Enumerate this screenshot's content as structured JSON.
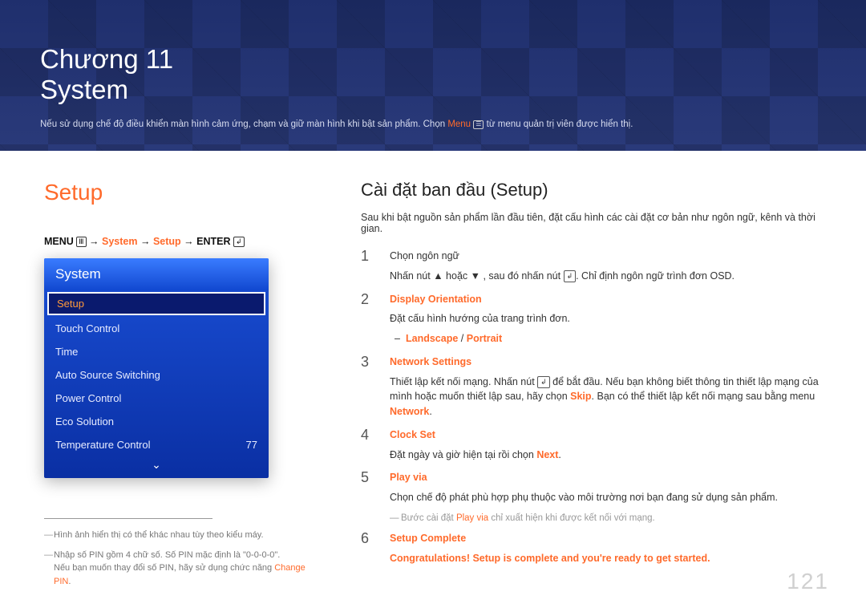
{
  "hero": {
    "chapter": "Chương 11",
    "title": "System",
    "note_pre": "Nếu sử dụng chế độ điều khiển màn hình cảm ứng, chạm và giữ màn hình khi bật sản phẩm. Chọn ",
    "note_menu": "Menu",
    "note_post": " từ menu quản trị viên được hiển thị."
  },
  "left": {
    "heading": "Setup",
    "breadcrumb": {
      "menu": "MENU",
      "arrow": "→",
      "p1": "System",
      "p2": "Setup",
      "enter": "ENTER"
    },
    "osd": {
      "header": "System",
      "items": [
        {
          "label": "Setup",
          "selected": true
        },
        {
          "label": "Touch Control"
        },
        {
          "label": "Time"
        },
        {
          "label": "Auto Source Switching"
        },
        {
          "label": "Power Control"
        },
        {
          "label": "Eco Solution"
        },
        {
          "label": "Temperature Control",
          "value": "77"
        }
      ],
      "more": "⌄"
    },
    "footnote1": "Hình ảnh hiển thị có thể khác nhau tùy theo kiểu máy.",
    "footnote2_a": "Nhập số PIN gồm 4 chữ số. Số PIN mặc định là \"0-0-0-0\".",
    "footnote2_b_pre": "Nếu bạn muốn thay đổi số PIN, hãy sử dụng chức năng ",
    "footnote2_b_hl": "Change PIN",
    "footnote2_b_post": "."
  },
  "right": {
    "heading": "Cài đặt ban đầu (Setup)",
    "intro": "Sau khi bật nguồn sản phẩm lần đầu tiên, đặt cấu hình các cài đặt cơ bản như ngôn ngữ, kênh và thời gian.",
    "steps": {
      "s1": {
        "num": "1",
        "line1": "Chọn ngôn ngữ",
        "line2_a": "Nhấn nút ▲ hoặc ▼ , sau đó nhấn nút ",
        "line2_b": ". Chỉ định ngôn ngữ trình đơn OSD."
      },
      "s2": {
        "num": "2",
        "title": "Display Orientation",
        "line1": "Đặt cấu hình hướng của trang trình đơn.",
        "sub_a": "Landscape",
        "sub_sep": " / ",
        "sub_b": "Portrait"
      },
      "s3": {
        "num": "3",
        "title": "Network Settings",
        "line1_a": "Thiết lập kết nối mạng. Nhấn nút ",
        "line1_b": " để bắt đầu. Nếu bạn không biết thông tin thiết lập mạng của mình hoặc muốn thiết lập sau, hãy chọn ",
        "skip": "Skip",
        "line1_c": ". Bạn có thể thiết lập kết nối mạng sau bằng menu ",
        "network": "Network",
        "line1_d": "."
      },
      "s4": {
        "num": "4",
        "title": "Clock Set",
        "line1_a": "Đặt ngày và giờ hiện tại rồi chọn ",
        "next": "Next",
        "line1_b": "."
      },
      "s5": {
        "num": "5",
        "title": "Play via",
        "line1": "Chọn chế độ phát phù hợp phụ thuộc vào môi trường nơi bạn đang sử dụng sản phẩm."
      },
      "s5_note_a": "Bước cài đặt ",
      "s5_note_hl": "Play via",
      "s5_note_b": " chỉ xuất hiện khi được kết nối với mạng.",
      "s6": {
        "num": "6",
        "title": "Setup Complete",
        "line1": "Congratulations! Setup is complete and you're ready to get started."
      }
    }
  },
  "page_number": "121"
}
